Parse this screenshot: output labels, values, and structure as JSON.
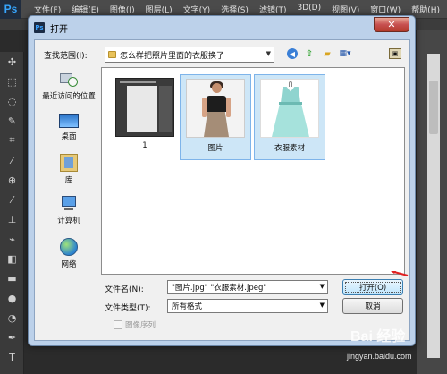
{
  "ps": {
    "logo": "Ps",
    "menu": [
      "文件(F)",
      "编辑(E)",
      "图像(I)",
      "图层(L)",
      "文字(Y)",
      "选择(S)",
      "滤镜(T)",
      "3D(D)",
      "视图(V)",
      "窗口(W)",
      "帮助(H)"
    ],
    "tools": [
      "move-tool-icon",
      "marquee-tool-icon",
      "lasso-tool-icon",
      "quick-select-tool-icon",
      "crop-tool-icon",
      "eyedropper-tool-icon",
      "healing-tool-icon",
      "brush-tool-icon",
      "stamp-tool-icon",
      "history-brush-tool-icon",
      "eraser-tool-icon",
      "gradient-tool-icon",
      "blur-tool-icon",
      "dodge-tool-icon",
      "pen-tool-icon",
      "type-tool-icon",
      "path-select-tool-icon"
    ]
  },
  "dialog": {
    "title": "打开",
    "title_icon": "Ps",
    "close_label": "✕",
    "look_in_label": "查找范围(I):",
    "look_in_value": "怎么样把照片里面的衣服换了",
    "places": [
      {
        "label": "最近访问的位置",
        "icon": "recent-places-icon"
      },
      {
        "label": "桌面",
        "icon": "desktop-icon"
      },
      {
        "label": "库",
        "icon": "library-icon"
      },
      {
        "label": "计算机",
        "icon": "computer-icon"
      },
      {
        "label": "网络",
        "icon": "network-icon"
      }
    ],
    "files": [
      {
        "name": "1",
        "selected": false
      },
      {
        "name": "图片",
        "selected": true
      },
      {
        "name": "衣服素材",
        "selected": true
      }
    ],
    "filename_label": "文件名(N):",
    "filename_value": "\"图片.jpg\" \"衣服素材.jpeg\"",
    "filetype_label": "文件类型(T):",
    "filetype_value": "所有格式",
    "open_button": "打开(O)",
    "cancel_button": "取消",
    "image_sequence_label": "图像序列"
  },
  "watermark": {
    "text": "Bai 经验",
    "url": "jingyan.baidu.com"
  }
}
